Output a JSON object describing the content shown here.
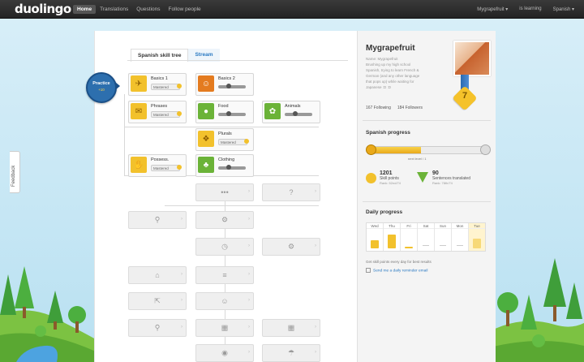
{
  "app": {
    "logo": "duolingo"
  },
  "nav": {
    "items": [
      "Home",
      "Translations",
      "Questions",
      "Follow people"
    ],
    "right": [
      "Mygrapefruit ▾",
      "is learning",
      "Spanish ▾"
    ]
  },
  "feedback": "Feedback",
  "tree": {
    "tabs": [
      "Spanish skill tree",
      "Stream"
    ],
    "practice": {
      "label": "Practice",
      "coins": "+10"
    },
    "skills": {
      "basics1": {
        "name": "Basics 1",
        "badge": "Mastered"
      },
      "basics2": {
        "name": "Basics 2"
      },
      "phrases": {
        "name": "Phrases",
        "badge": "Mastered"
      },
      "food": {
        "name": "Food"
      },
      "animals": {
        "name": "Animals"
      },
      "plurals": {
        "name": "Plurals",
        "badge": "Mastered"
      },
      "possess": {
        "name": "Possess.",
        "badge": "Mastered"
      },
      "clothing": {
        "name": "Clothing"
      }
    }
  },
  "profile": {
    "username": "Mygrapefruit",
    "lines": [
      "Name: Mygrapefruit",
      "Brushing up my high school",
      "Spanish, trying to learn French &",
      "German (and any other language",
      "that pops up) while waiting for",
      "Japanese :D :D"
    ],
    "following": "167 Following",
    "followers": "184 Followers",
    "level": "7"
  },
  "progress": {
    "title": "Spanish progress",
    "next_label": "next level / 1"
  },
  "stats": {
    "skill_points": {
      "num": "1201",
      "label": "Skill points",
      "sub": "Rank: 52nd/74"
    },
    "sentences": {
      "num": "90",
      "label": "Sentences translated",
      "sub": "Rank: 78th/74"
    }
  },
  "daily": {
    "title": "Daily progress",
    "days": [
      "Wed",
      "Thu",
      "Fri",
      "Sat",
      "Sun",
      "Mon",
      "Tue"
    ],
    "goal_text": "Get skill points every day for best results",
    "reminder": "Send me a daily reminder email"
  },
  "colors": {
    "gold": "#f2c12c",
    "orange": "#e47b1f",
    "green": "#6bb338",
    "blue": "#2d6fae"
  }
}
